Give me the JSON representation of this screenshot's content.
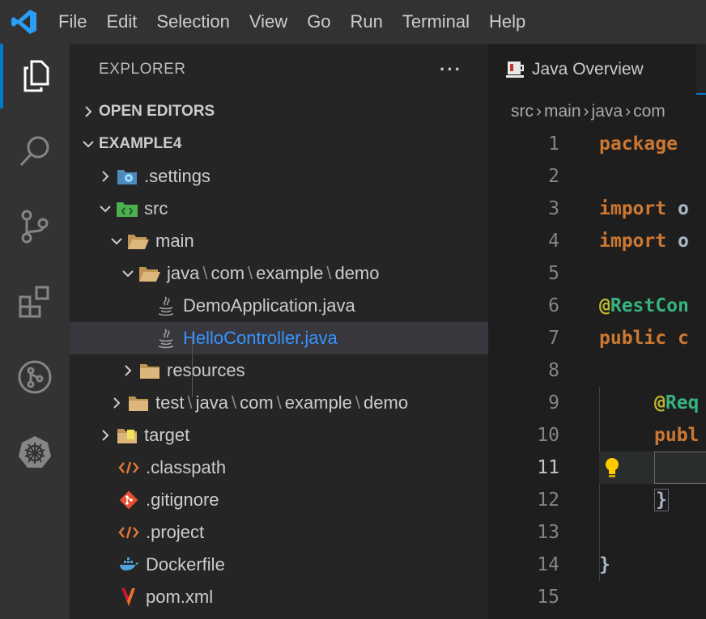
{
  "menubar": {
    "items": [
      "File",
      "Edit",
      "Selection",
      "View",
      "Go",
      "Run",
      "Terminal",
      "Help"
    ],
    "accent": "#007acc"
  },
  "activity_icons": [
    "explorer-icon",
    "search-icon",
    "source-control-icon",
    "extensions-icon",
    "git-graph-icon",
    "kubernetes-icon"
  ],
  "sidebar": {
    "title": "EXPLORER",
    "more": "···",
    "open_editors": "OPEN EDITORS",
    "workspace": "EXAMPLE4",
    "settings": ".settings",
    "src": "src",
    "main": "main",
    "java_path": [
      "java",
      "com",
      "example",
      "demo"
    ],
    "demo_app": "DemoApplication.java",
    "hello_controller": "HelloController.java",
    "resources": "resources",
    "test_path": [
      "test",
      "java",
      "com",
      "example",
      "demo"
    ],
    "target": "target",
    "classpath": ".classpath",
    "gitignore": ".gitignore",
    "project": ".project",
    "dockerfile": "Dockerfile",
    "pom": "pom.xml"
  },
  "editor": {
    "tab_label": "Java Overview",
    "breadcrumbs": [
      "src",
      "main",
      "java",
      "com"
    ],
    "lines": {
      "l1": "package",
      "l3_kw": "import",
      "l3_txt": "o",
      "l4_kw": "import",
      "l4_txt": "o",
      "l6_at": "@",
      "l6_name": "RestCon",
      "l7_kw": "public",
      "l7_txt": "c",
      "l9_at": "@",
      "l9_name": "Req",
      "l10_kw": "publ",
      "l12": "}",
      "l14": "}"
    },
    "line_numbers": [
      "1",
      "2",
      "3",
      "4",
      "5",
      "6",
      "7",
      "8",
      "9",
      "10",
      "11",
      "12",
      "13",
      "14",
      "15"
    ]
  }
}
